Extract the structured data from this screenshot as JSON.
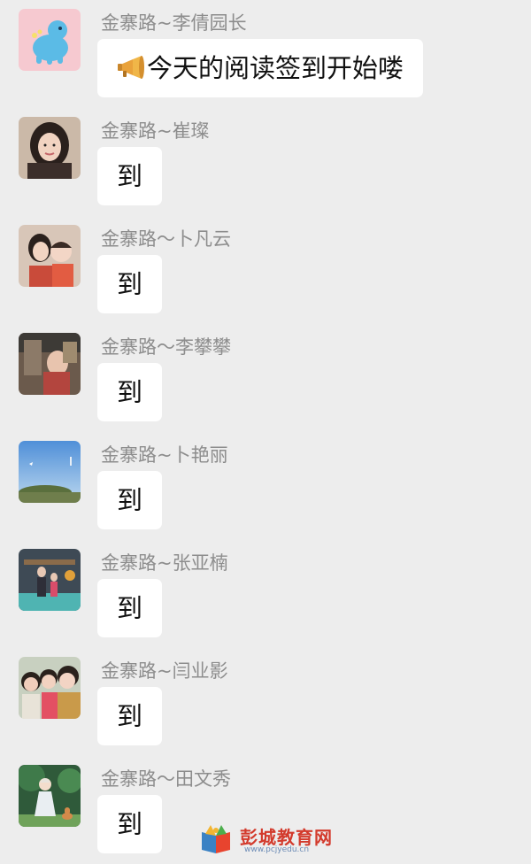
{
  "messages": [
    {
      "sender": "金寨路~李倩园长",
      "text": "今天的阅读签到开始喽",
      "icon": "megaphone-icon"
    },
    {
      "sender": "金寨路~崔璨",
      "text": "到"
    },
    {
      "sender": "金寨路～卜凡云",
      "text": "到"
    },
    {
      "sender": "金寨路～李攀攀",
      "text": "到"
    },
    {
      "sender": "金寨路~卜艳丽",
      "text": "到"
    },
    {
      "sender": "金寨路~张亚楠",
      "text": "到"
    },
    {
      "sender": "金寨路~闫业影",
      "text": "到"
    },
    {
      "sender": "金寨路～田文秀",
      "text": "到"
    }
  ],
  "watermark": {
    "name": "彭城教育网",
    "url": "www.pcjyedu.cn"
  }
}
